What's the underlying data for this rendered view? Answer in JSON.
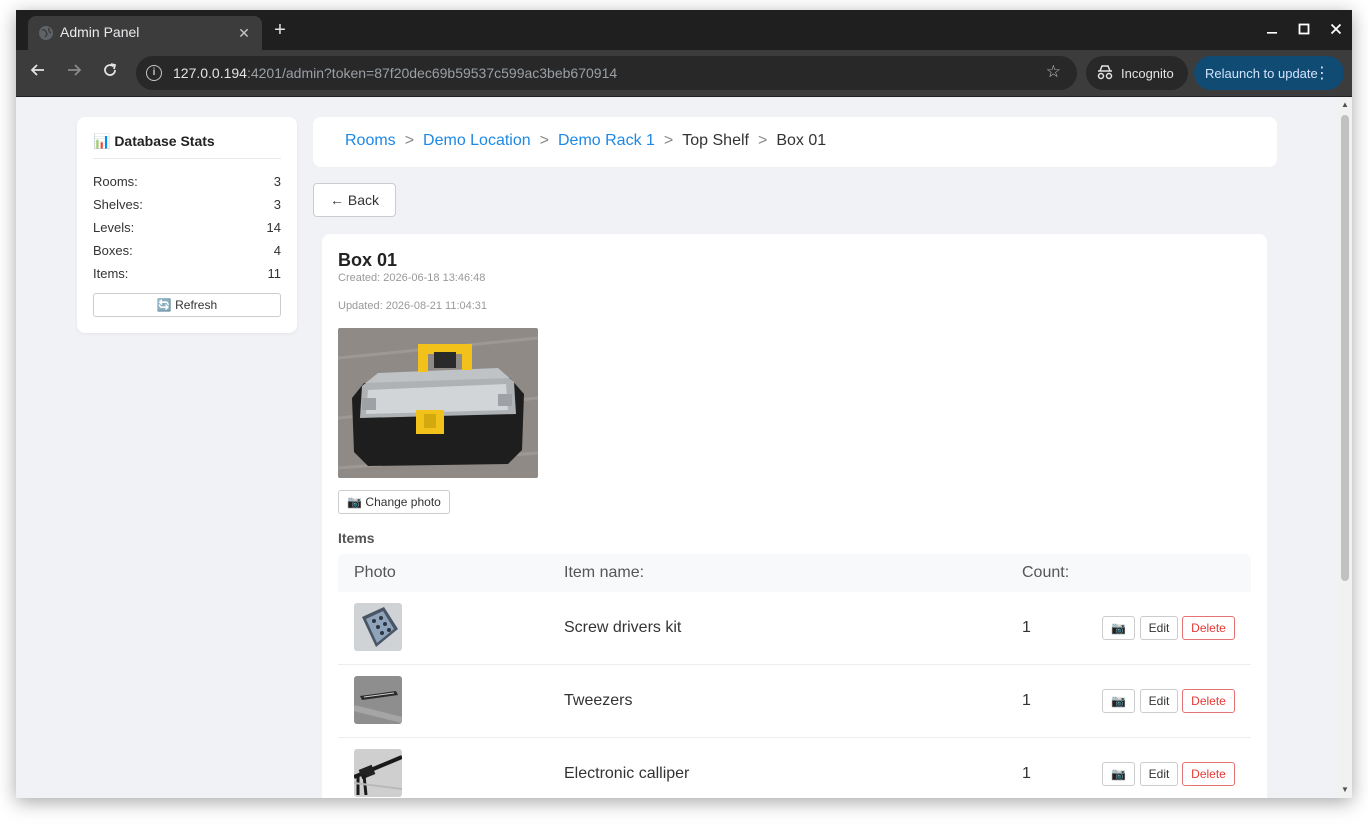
{
  "browser": {
    "tab_title": "Admin Panel",
    "url_host": "127.0.0.194",
    "url_rest": ":4201/admin?token=87f20dec69b59537c599ac3beb670914",
    "incognito_label": "Incognito",
    "relaunch_label": "Relaunch to update"
  },
  "stats": {
    "title": "📊 Database Stats",
    "rows": [
      {
        "label": "Rooms:",
        "value": "3"
      },
      {
        "label": "Shelves:",
        "value": "3"
      },
      {
        "label": "Levels:",
        "value": "14"
      },
      {
        "label": "Boxes:",
        "value": "4"
      },
      {
        "label": "Items:",
        "value": "11"
      }
    ],
    "refresh_label": "🔄 Refresh"
  },
  "breadcrumb": {
    "items": [
      "Rooms",
      "Demo Location",
      "Demo Rack 1",
      "Top Shelf",
      "Box 01"
    ],
    "separator": ">"
  },
  "back_label": "← Back",
  "box": {
    "title": "Box 01",
    "created": "Created: 2026-06-18 13:46:48",
    "updated": "Updated: 2026-08-21 11:04:31",
    "change_photo_label": "📷 Change photo",
    "items_label": "Items"
  },
  "table": {
    "headers": {
      "photo": "Photo",
      "name": "Item name:",
      "count": "Count:"
    },
    "rows": [
      {
        "name": "Screw drivers kit",
        "count": "1"
      },
      {
        "name": "Tweezers",
        "count": "1"
      },
      {
        "name": "Electronic calliper",
        "count": "1"
      }
    ],
    "photo_btn": "📷",
    "edit_btn": "Edit",
    "delete_btn": "Delete"
  },
  "colors": {
    "link": "#1e88e5",
    "delete": "#e53935",
    "page_bg": "#f0f2f5"
  }
}
